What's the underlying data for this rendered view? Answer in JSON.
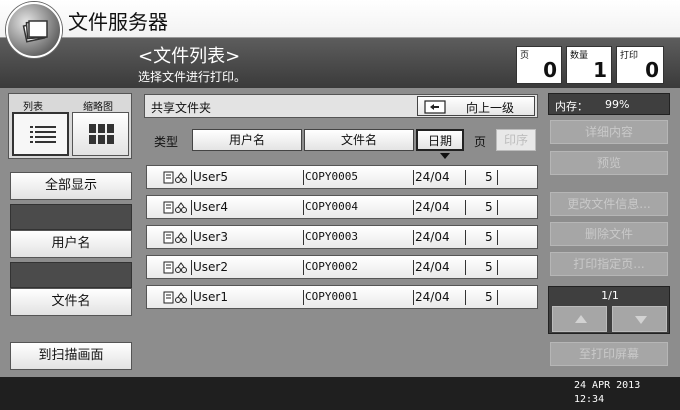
{
  "app": {
    "title": "文件服务器",
    "logo_icon": "document-server-icon"
  },
  "header": {
    "title": "<文件列表>",
    "subtitle": "选择文件进行打印。",
    "counters": [
      {
        "label": "页",
        "value": "0"
      },
      {
        "label": "数量",
        "value": "1"
      },
      {
        "label": "打印",
        "value": "0"
      }
    ]
  },
  "view_toggle": {
    "list_label": "列表",
    "thumb_label": "缩略图",
    "selected": "list"
  },
  "left": {
    "show_all": "全部显示",
    "user_name": "用户名",
    "file_name": "文件名",
    "to_scan": "到扫描画面"
  },
  "folder": {
    "label": "共享文件夹",
    "up_button": "向上一级"
  },
  "sort": {
    "type_label": "类型",
    "user_col": "用户名",
    "file_col": "文件名",
    "date_col": "日期",
    "pages_label": "页",
    "print_order": "印序"
  },
  "files": [
    {
      "user": "User5",
      "file": "COPY0005",
      "date": "24/04",
      "pages": "5"
    },
    {
      "user": "User4",
      "file": "COPY0004",
      "date": "24/04",
      "pages": "5"
    },
    {
      "user": "User3",
      "file": "COPY0003",
      "date": "24/04",
      "pages": "5"
    },
    {
      "user": "User2",
      "file": "COPY0002",
      "date": "24/04",
      "pages": "5"
    },
    {
      "user": "User1",
      "file": "COPY0001",
      "date": "24/04",
      "pages": "5"
    }
  ],
  "right": {
    "memory_label": "内存：",
    "memory_value": "99%",
    "details": "详细内容",
    "preview": "预览",
    "change_info": "更改文件信息...",
    "delete_file": "删除文件",
    "print_page": "打印指定页...",
    "page_indicator": "1/1",
    "to_print": "至打印屏幕"
  },
  "status": {
    "date": "24 APR  2013",
    "time": "12:34"
  },
  "colors": {
    "header_bg": "#4a4a4a",
    "body_bg": "#8d8d8d",
    "footer_bg": "#1f1f1f"
  }
}
